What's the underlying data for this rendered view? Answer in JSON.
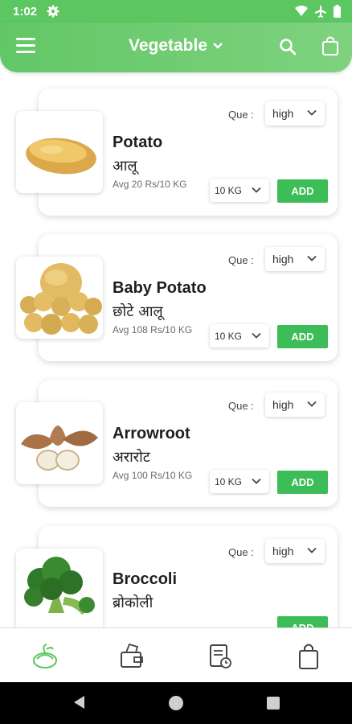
{
  "status_bar": {
    "time": "1:02"
  },
  "header": {
    "category": "Vegetable"
  },
  "labels": {
    "que": "Que :",
    "add": "ADD"
  },
  "products": [
    {
      "name": "Potato",
      "local_name": "आलू",
      "price": "Avg 20 Rs/10 KG",
      "quality": "high",
      "quantity": "10 KG"
    },
    {
      "name": "Baby Potato",
      "local_name": "छोटे आलू",
      "price": "Avg 108 Rs/10 KG",
      "quality": "high",
      "quantity": "10 KG"
    },
    {
      "name": "Arrowroot",
      "local_name": "अरारोट",
      "price": "Avg 100 Rs/10 KG",
      "quality": "high",
      "quantity": "10 KG"
    },
    {
      "name": "Broccoli",
      "local_name": "ब्रोकोली",
      "price": "",
      "quality": "high",
      "quantity": ""
    }
  ],
  "bottom_nav": {
    "items": [
      {
        "icon": "vegetable-basket-icon",
        "active": true
      },
      {
        "icon": "wallet-icon",
        "active": false
      },
      {
        "icon": "order-history-icon",
        "active": false
      },
      {
        "icon": "shopping-bag-icon",
        "active": false
      }
    ]
  },
  "colors": {
    "primary": "#5cc661",
    "add_button": "#3dbd57"
  }
}
